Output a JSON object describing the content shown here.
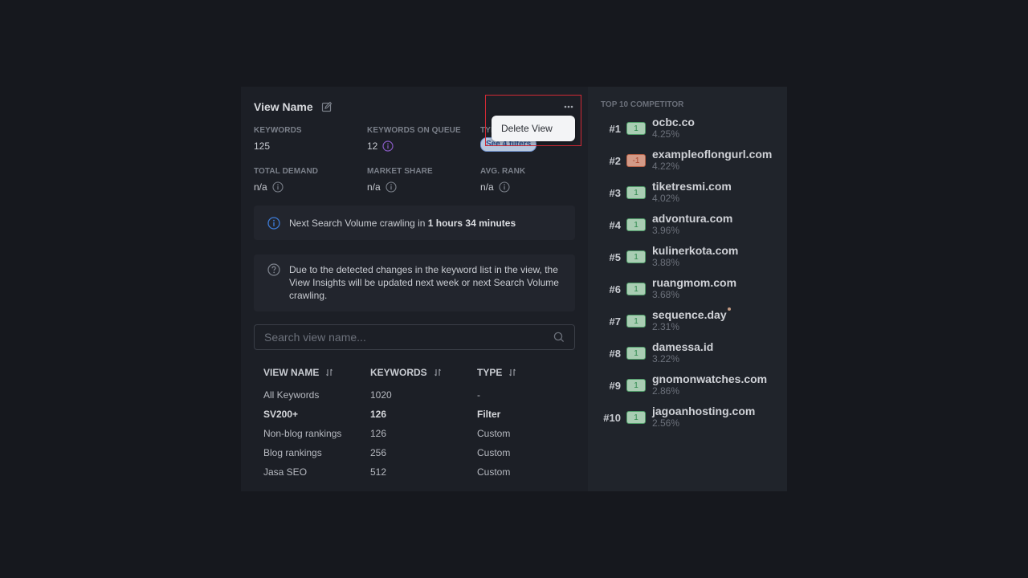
{
  "view": {
    "title": "View Name",
    "icons": {
      "edit": "edit-icon",
      "more": "more-horizontal-icon"
    }
  },
  "stats": [
    {
      "label": "KEYWORDS",
      "value": "125"
    },
    {
      "label": "KEYWORDS ON QUEUE",
      "value": "12",
      "icon": "info-icon"
    },
    {
      "label": "TYPE",
      "chip": "See 4 filters"
    },
    {
      "label": "TOTAL DEMAND",
      "value": "n/a",
      "icon": "info-icon"
    },
    {
      "label": "MARKET SHARE",
      "value": "n/a",
      "icon": "info-icon"
    },
    {
      "label": "AVG. RANK",
      "value": "n/a",
      "icon": "info-icon"
    }
  ],
  "notices": {
    "crawl": {
      "prefix": "Next Search Volume crawling in ",
      "time": "1 hours 34 minutes"
    },
    "changes": {
      "text": "Due to the detected changes in the keyword list in the view, the View Insights will be updated next week or next Search Volume crawling."
    }
  },
  "search": {
    "placeholder": "Search view name...",
    "value": ""
  },
  "table": {
    "headers": [
      "VIEW NAME",
      "KEYWORDS",
      "TYPE"
    ],
    "rows": [
      {
        "name": "All Keywords",
        "keywords": "1020",
        "type": "-"
      },
      {
        "name": "SV200+",
        "keywords": "126",
        "type": "Filter",
        "bold": true
      },
      {
        "name": "Non-blog rankings",
        "keywords": "126",
        "type": "Custom"
      },
      {
        "name": "Blog rankings",
        "keywords": "256",
        "type": "Custom"
      },
      {
        "name": "Jasa SEO",
        "keywords": "512",
        "type": "Custom"
      }
    ]
  },
  "menu": {
    "delete_label": "Delete View"
  },
  "competitors": {
    "title": "TOP 10 COMPETITOR",
    "items": [
      {
        "rank": "#1",
        "change": "1",
        "dir": "up",
        "domain": "ocbc.co",
        "share": "4.25%"
      },
      {
        "rank": "#2",
        "change": "-1",
        "dir": "down",
        "domain": "exampleoflongurl.com",
        "share": "4.22%"
      },
      {
        "rank": "#3",
        "change": "1",
        "dir": "up",
        "domain": "tiketresmi.com",
        "share": "4.02%"
      },
      {
        "rank": "#4",
        "change": "1",
        "dir": "up",
        "domain": "advontura.com",
        "share": "3.96%"
      },
      {
        "rank": "#5",
        "change": "1",
        "dir": "up",
        "domain": "kulinerkota.com",
        "share": "3.88%"
      },
      {
        "rank": "#6",
        "change": "1",
        "dir": "up",
        "domain": "ruangmom.com",
        "share": "3.68%"
      },
      {
        "rank": "#7",
        "change": "1",
        "dir": "up",
        "domain": "sequence.day",
        "share": "2.31%",
        "dot": true
      },
      {
        "rank": "#8",
        "change": "1",
        "dir": "up",
        "domain": "damessa.id",
        "share": "3.22%"
      },
      {
        "rank": "#9",
        "change": "1",
        "dir": "up",
        "domain": "gnomonwatches.com",
        "share": "2.86%"
      },
      {
        "rank": "#10",
        "change": "1",
        "dir": "up",
        "domain": "jagoanhosting.com",
        "share": "2.56%"
      }
    ]
  },
  "colors": {
    "page_bg": "#16181e",
    "panel_bg": "#1c1f26",
    "side_bg": "#20242b",
    "up_badge": "#a9cdb3",
    "down_badge": "#d39a87",
    "info_accent": "#3d7bd6",
    "queue_info": "#8a5cc7",
    "highlight_border": "#d22a35"
  }
}
